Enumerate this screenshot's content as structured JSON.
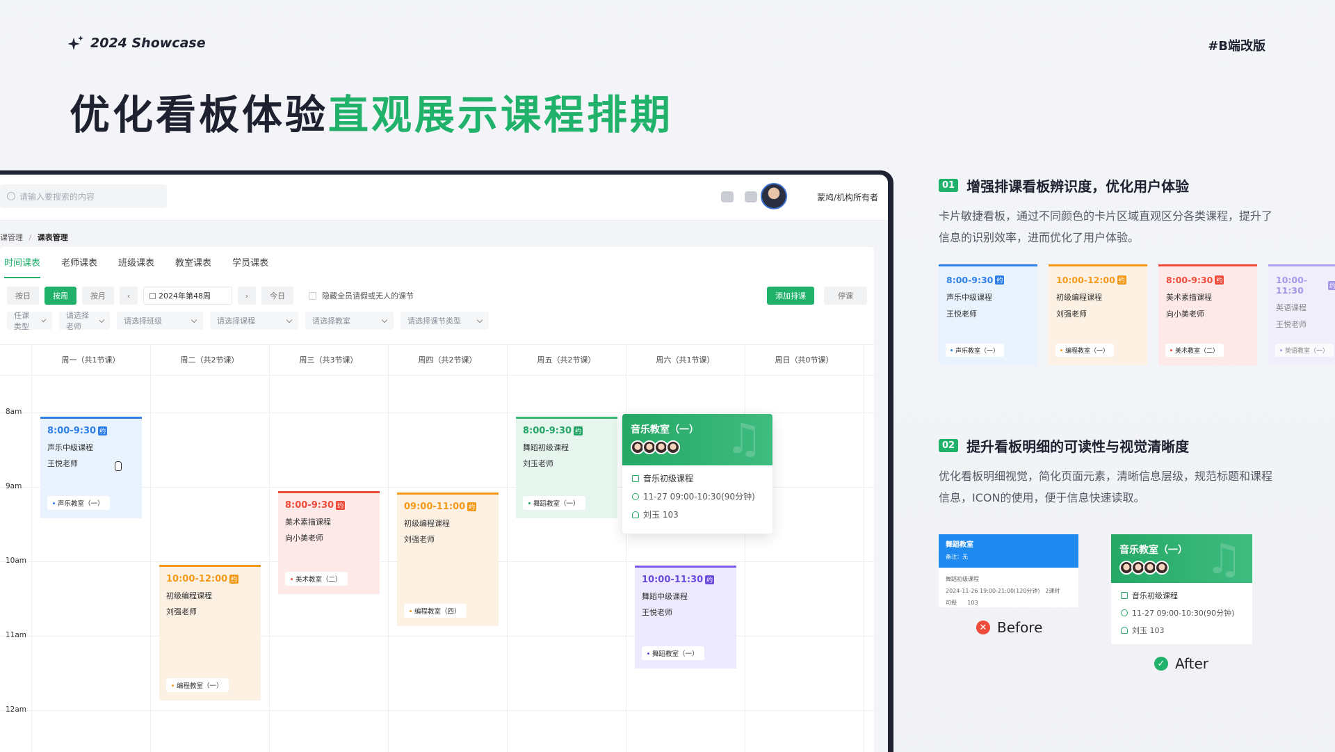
{
  "header": {
    "brand": "2024 Showcase",
    "tag": "#B端改版",
    "headline_dark": "优化看板体验",
    "headline_green": "直观展示课程排期"
  },
  "app": {
    "search_placeholder": "请输入要搜索的内容",
    "user_name": "蒙鸠/机构所有者",
    "breadcrumb": {
      "parent": "课管理",
      "sep": "/",
      "current": "课表管理"
    },
    "tabs": [
      "时间课表",
      "老师课表",
      "班级课表",
      "教室课表",
      "学员课表"
    ],
    "toolbar": {
      "by_day": "按日",
      "by_week": "按周",
      "by_month": "按月",
      "prev": "‹",
      "next": "›",
      "week": "2024年第48周",
      "today": "今日",
      "hide_label": "隐藏全员请假或无人的课节",
      "add": "添加排课",
      "stop": "停课"
    },
    "filters": [
      "任课类型",
      "请选择老师",
      "请选择班级",
      "请选择课程",
      "请选择教室",
      "请选择课节类型"
    ],
    "days": [
      "周一（共1节课）",
      "周二（共2节课）",
      "周三（共3节课）",
      "周四（共2节课）",
      "周五（共2节课）",
      "周六（共1节课）",
      "周日（共0节课）"
    ],
    "hours": [
      "8am",
      "9am",
      "10am",
      "11am",
      "12am"
    ],
    "cards": [
      {
        "time": "8:00-9:30",
        "badge": "约",
        "course": "声乐中级课程",
        "teacher": "王悦老师",
        "room": "声乐教室（一）",
        "color": "blue"
      },
      {
        "time": "10:00-12:00",
        "badge": "约",
        "course": "初级编程课程",
        "teacher": "刘强老师",
        "room": "编程教室（一）",
        "color": "orange"
      },
      {
        "time": "8:00-9:30",
        "badge": "约",
        "course": "美术素描课程",
        "teacher": "向小美老师",
        "room": "美术教室（二）",
        "color": "red"
      },
      {
        "time": "09:00-11:00",
        "badge": "约",
        "course": "初级编程课程",
        "teacher": "刘强老师",
        "room": "编程教室（四）",
        "color": "orange"
      },
      {
        "time": "8:00-9:30",
        "badge": "约",
        "course": "舞蹈初级课程",
        "teacher": "刘玉老师",
        "room": "舞蹈教室（一）",
        "color": "green"
      },
      {
        "time": "10:00-11:30",
        "badge": "约",
        "course": "舞蹈中级课程",
        "teacher": "王悦老师",
        "room": "舞蹈教室（一）",
        "color": "purple"
      }
    ],
    "popover": {
      "title": "音乐教室（一）",
      "course": "音乐初级课程",
      "datetime": "11-27 09:00-10:30(90分钟)",
      "teacher_room": "刘玉 103"
    }
  },
  "section1": {
    "num": "01",
    "title": "增强排课看板辨识度，优化用户体验",
    "desc": "卡片敏捷看板，通过不同颜色的卡片区域直观区分各类课程，提升了信息的识别效率，进而优化了用户体验。",
    "cards": [
      {
        "time": "8:00-9:30",
        "badge": "约",
        "course": "声乐中级课程",
        "teacher": "王悦老师",
        "room": "声乐教室（一）",
        "color": "blue"
      },
      {
        "time": "10:00-12:00",
        "badge": "约",
        "course": "初级编程课程",
        "teacher": "刘强老师",
        "room": "编程教室（一）",
        "color": "orange"
      },
      {
        "time": "8:00-9:30",
        "badge": "约",
        "course": "美术素描课程",
        "teacher": "向小美老师",
        "room": "美术教室（二）",
        "color": "red"
      },
      {
        "time": "10:00-11:30",
        "badge": "约",
        "course": "英语课程",
        "teacher": "王悦老师",
        "room": "英语教室（一）",
        "color": "purple"
      }
    ]
  },
  "section2": {
    "num": "02",
    "title": "提升看板明细的可读性与视觉清晰度",
    "desc": "优化看板明细视觉，简化页面元素，清晰信息层级，规范标题和课程信息，ICON的使用，便于信息快速读取。",
    "before": {
      "title": "舞蹈教室",
      "note": "备注：无",
      "course": "舞蹈初级课程",
      "datetime": "2024-11-26 19:00-21:00(120分钟)",
      "count": "2课时",
      "label": "可授",
      "room": "103",
      "verdict": "Before"
    },
    "after": {
      "title": "音乐教室（一）",
      "course": "音乐初级课程",
      "datetime": "11-27 09:00-10:30(90分钟)",
      "teacher_room": "刘玉 103",
      "verdict": "After"
    }
  }
}
